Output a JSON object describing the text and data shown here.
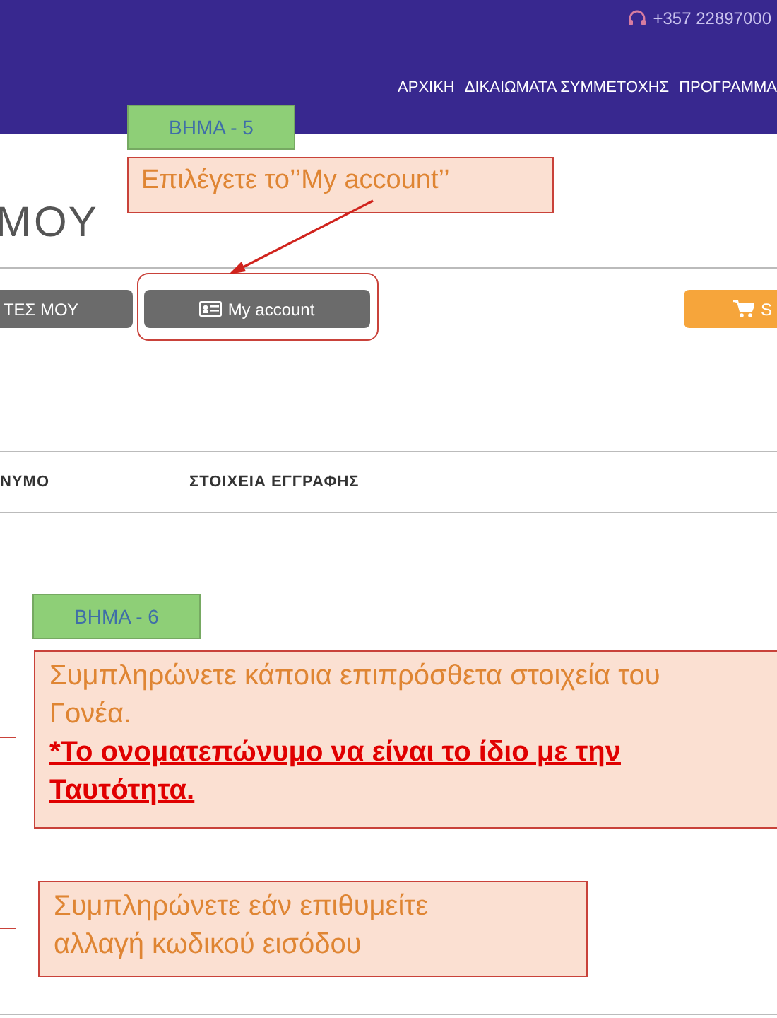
{
  "header": {
    "phone": "+357 22897000",
    "nav": [
      "ΑΡΧΙΚΗ",
      "ΔΙΚΑΙΩΜΑΤΑ ΣΥΜΜΕΤΟΧΗΣ",
      "ΠΡΟΓΡΑΜΜΑ"
    ]
  },
  "page_title": "ΜΟΥ",
  "buttons": [
    {
      "label": "ΤΕΣ ΜΟΥ",
      "kind": "grey"
    },
    {
      "label": "My account",
      "kind": "account"
    },
    {
      "label": "S",
      "kind": "cart"
    }
  ],
  "table": {
    "columns": [
      "ΝΥΜΟ",
      "ΣΤΟΙΧΕΙΑ ΕΓΓΡΑΦΗΣ"
    ]
  },
  "annotations": [
    {
      "kind": "step5",
      "step": "ΒΗΜΑ - 5",
      "note": "Επιλέγετε το’’My account’’"
    },
    {
      "kind": "step6",
      "step": "ΒΗΜΑ - 6",
      "note": "Συμπληρώνετε κάποια επιπρόσθετα στοιχεία του Γονέα.",
      "warning": "*Το ονοματεπώνυμο να είναι το ίδιο με την Ταυτότητα."
    },
    {
      "kind": "password",
      "note": "Συμπληρώνετε εάν επιθυμείτε αλλαγή κωδικού εισόδου"
    }
  ]
}
